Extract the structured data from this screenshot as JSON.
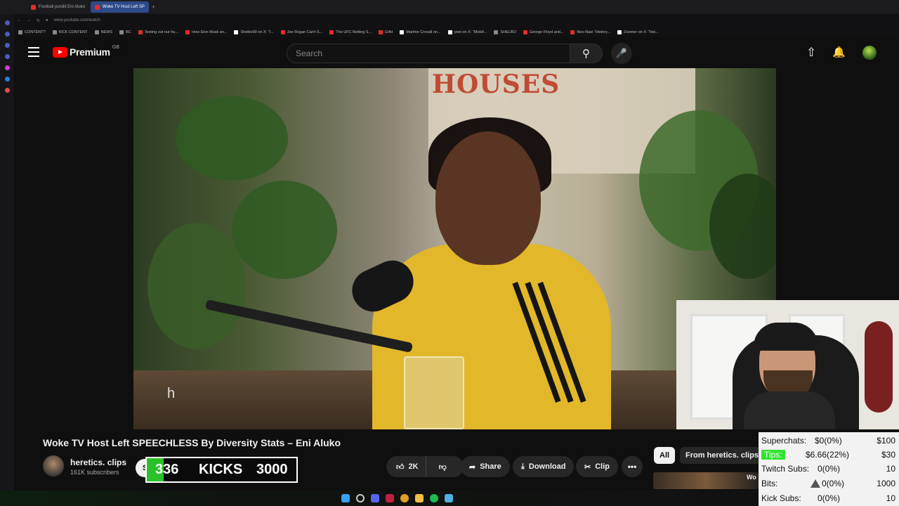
{
  "browser": {
    "tabs": [
      {
        "label": "Football pundit Eni Aluko",
        "active": false
      },
      {
        "label": "Woke TV Host Left SP",
        "active": true
      }
    ],
    "url": "www.youtube.com/watch",
    "bookmarks": [
      "CONTENT?",
      "KICK CONTENT",
      "NEWS",
      "BC",
      "Testing out our hu...",
      "How Elon Musk an...",
      "Shelbo99 on X: \"I...",
      "Joe Rogan Can't S...",
      "The UFC Betting S...",
      "G4H",
      "Martine Croxall on...",
      "yeet on X: \"Mizkif...",
      "SHELBO",
      "George Floyd and...",
      "Neo-Nazi \"History...",
      "Zoomer on X: \"Hei..."
    ]
  },
  "header": {
    "logo_text": "Premium",
    "logo_country": "GB",
    "search_placeholder": "Search",
    "icons": [
      "menu-icon",
      "search-icon",
      "mic-icon",
      "upload-icon",
      "bell-icon",
      "avatar"
    ]
  },
  "video": {
    "sign_text": "HOUSES",
    "caption": "h"
  },
  "watch": {
    "title": "Woke TV Host Left SPEECHLESS By Diversity Stats – Eni Aluko",
    "channel_name": "heretics. clips",
    "subscribers": "161K subscribers",
    "subscribe_label": "S",
    "like_count": "2K",
    "share_label": "Share",
    "download_label": "Download",
    "clip_label": "Clip",
    "more_label": "•••"
  },
  "kicks": {
    "current": "336",
    "label": "KICKS",
    "target": "3000",
    "progress": 0.112
  },
  "related": {
    "chip_all": "All",
    "chip_from": "From heretics. clips",
    "thumb_text": "Wo Ho"
  },
  "stats": {
    "rows": [
      {
        "label": "Superchats:",
        "value": "$0(0%)",
        "goal": "$100"
      },
      {
        "label": "Tips:",
        "value": "$6.66(22%)",
        "goal": "$30"
      },
      {
        "label": "Twitch Subs:",
        "value": "0(0%)",
        "goal": "10"
      },
      {
        "label": "Bits:",
        "value": "0(0%)",
        "goal": "1000"
      },
      {
        "label": "Kick Subs:",
        "value": "0(0%)",
        "goal": "10"
      }
    ],
    "tips_highlight": "#2ee52e"
  },
  "colors": {
    "brand": "#ff0000",
    "background": "#0f0f0f",
    "kicks_fill": "#29c22a"
  }
}
